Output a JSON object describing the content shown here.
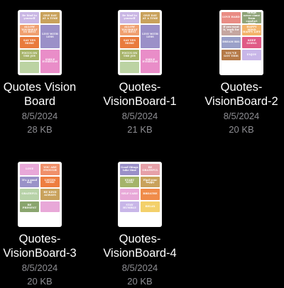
{
  "files": [
    {
      "name_line1": "Quotes Vision",
      "name_line2": "Board",
      "date": "8/5/2024",
      "size": "28 KB",
      "tiles": [
        {
          "text": "Be kind to yourself",
          "color": "#c9b6e4",
          "cls": ""
        },
        {
          "text": "ONE DAY AT A TIME",
          "color": "#c9a25c",
          "cls": ""
        },
        {
          "text": "ALLOW YOURSELF TO REST",
          "color": "#f0a070",
          "cls": ""
        },
        {
          "text": "LIVE WITH LESS",
          "color": "#9b90c8",
          "cls": "tall"
        },
        {
          "text": "SAY YES MORE",
          "color": "#e97b3d",
          "cls": ""
        },
        {
          "text": "FOCUS ON THE JOY",
          "color": "#a7b46a",
          "cls": ""
        },
        {
          "text": "SMILE EVERYDAY",
          "color": "#e98dc8",
          "cls": "tall"
        },
        {
          "text": "",
          "color": "#bcd3a3",
          "cls": ""
        }
      ]
    },
    {
      "name_line1": "Quotes-",
      "name_line2": "VisionBoard-1",
      "date": "8/5/2024",
      "size": "21 KB",
      "tiles": [
        {
          "text": "Be kind to yourself",
          "color": "#c9b6e4",
          "cls": ""
        },
        {
          "text": "ONE DAY AT A TIME",
          "color": "#c9a25c",
          "cls": ""
        },
        {
          "text": "ALLOW YOURSELF TO REST",
          "color": "#f0a070",
          "cls": ""
        },
        {
          "text": "LIVE WITH LESS",
          "color": "#9b90c8",
          "cls": "tall"
        },
        {
          "text": "SAY YES MORE",
          "color": "#e97b3d",
          "cls": ""
        },
        {
          "text": "FOCUS ON THE JOY",
          "color": "#a7b46a",
          "cls": ""
        },
        {
          "text": "SMILE EVERYDAY",
          "color": "#e98dc8",
          "cls": "tall"
        },
        {
          "text": "",
          "color": "#bcd3a3",
          "cls": ""
        }
      ]
    },
    {
      "name_line1": "Quotes-",
      "name_line2": "VisionBoard-2",
      "date": "8/5/2024",
      "size": "20 KB",
      "tiles": [
        {
          "text": "LOVE HARD",
          "color": "#e98c84",
          "cls": ""
        },
        {
          "text": "Great things never came from comfort zones",
          "color": "#8fa378",
          "cls": ""
        },
        {
          "text": "If you want it, work for it",
          "color": "#c5a6a0",
          "cls": ""
        },
        {
          "text": "HAPPY MIND HAPPY LIFE",
          "color": "#f3b36a",
          "cls": ""
        },
        {
          "text": "DREAM BIG",
          "color": "#9aa0c8",
          "cls": ""
        },
        {
          "text": "KEEP GOING",
          "color": "#e05a86",
          "cls": ""
        },
        {
          "text": "YOU'VE GOT THIS",
          "color": "#b57a48",
          "cls": ""
        },
        {
          "text": "ENJOY",
          "color": "#c8b6e8",
          "cls": ""
        }
      ]
    },
    {
      "name_line1": "Quotes-",
      "name_line2": "VisionBoard-3",
      "date": "8/5/2024",
      "size": "20 KB",
      "tiles": [
        {
          "text": "LOVE",
          "color": "#e8a8d8",
          "cls": ""
        },
        {
          "text": "YOU ARE ENOUGH",
          "color": "#f0906a",
          "cls": ""
        },
        {
          "text": "It's a good day",
          "color": "#9a92c8",
          "cls": ""
        },
        {
          "text": "LISTEN MORE",
          "color": "#ee7e40",
          "cls": ""
        },
        {
          "text": "GRATEFUL",
          "color": "#b7d2a8",
          "cls": ""
        },
        {
          "text": "BE KIND ALWAYS",
          "color": "#c9a25c",
          "cls": ""
        },
        {
          "text": "BE PRESENT",
          "color": "#8aa56e",
          "cls": ""
        },
        {
          "text": "",
          "color": "#e8a8d8",
          "cls": ""
        }
      ]
    },
    {
      "name_line1": "Quotes-",
      "name_line2": "VisionBoard-4",
      "date": "8/5/2024",
      "size": "20 KB",
      "tiles": [
        {
          "text": "Good things take time",
          "color": "#9a90c8",
          "cls": ""
        },
        {
          "text": "BE GRATEFUL",
          "color": "#e6a0a8",
          "cls": ""
        },
        {
          "text": "START NOW",
          "color": "#a4b46a",
          "cls": ""
        },
        {
          "text": "Find your happy",
          "color": "#c9a25c",
          "cls": ""
        },
        {
          "text": "SELF CARE",
          "color": "#e8a8d8",
          "cls": ""
        },
        {
          "text": "BREATHE",
          "color": "#f08c4a",
          "cls": ""
        },
        {
          "text": "STAY HUMBLE",
          "color": "#c8b6e8",
          "cls": ""
        },
        {
          "text": "RELAX",
          "color": "#f3d06a",
          "cls": ""
        }
      ]
    }
  ]
}
